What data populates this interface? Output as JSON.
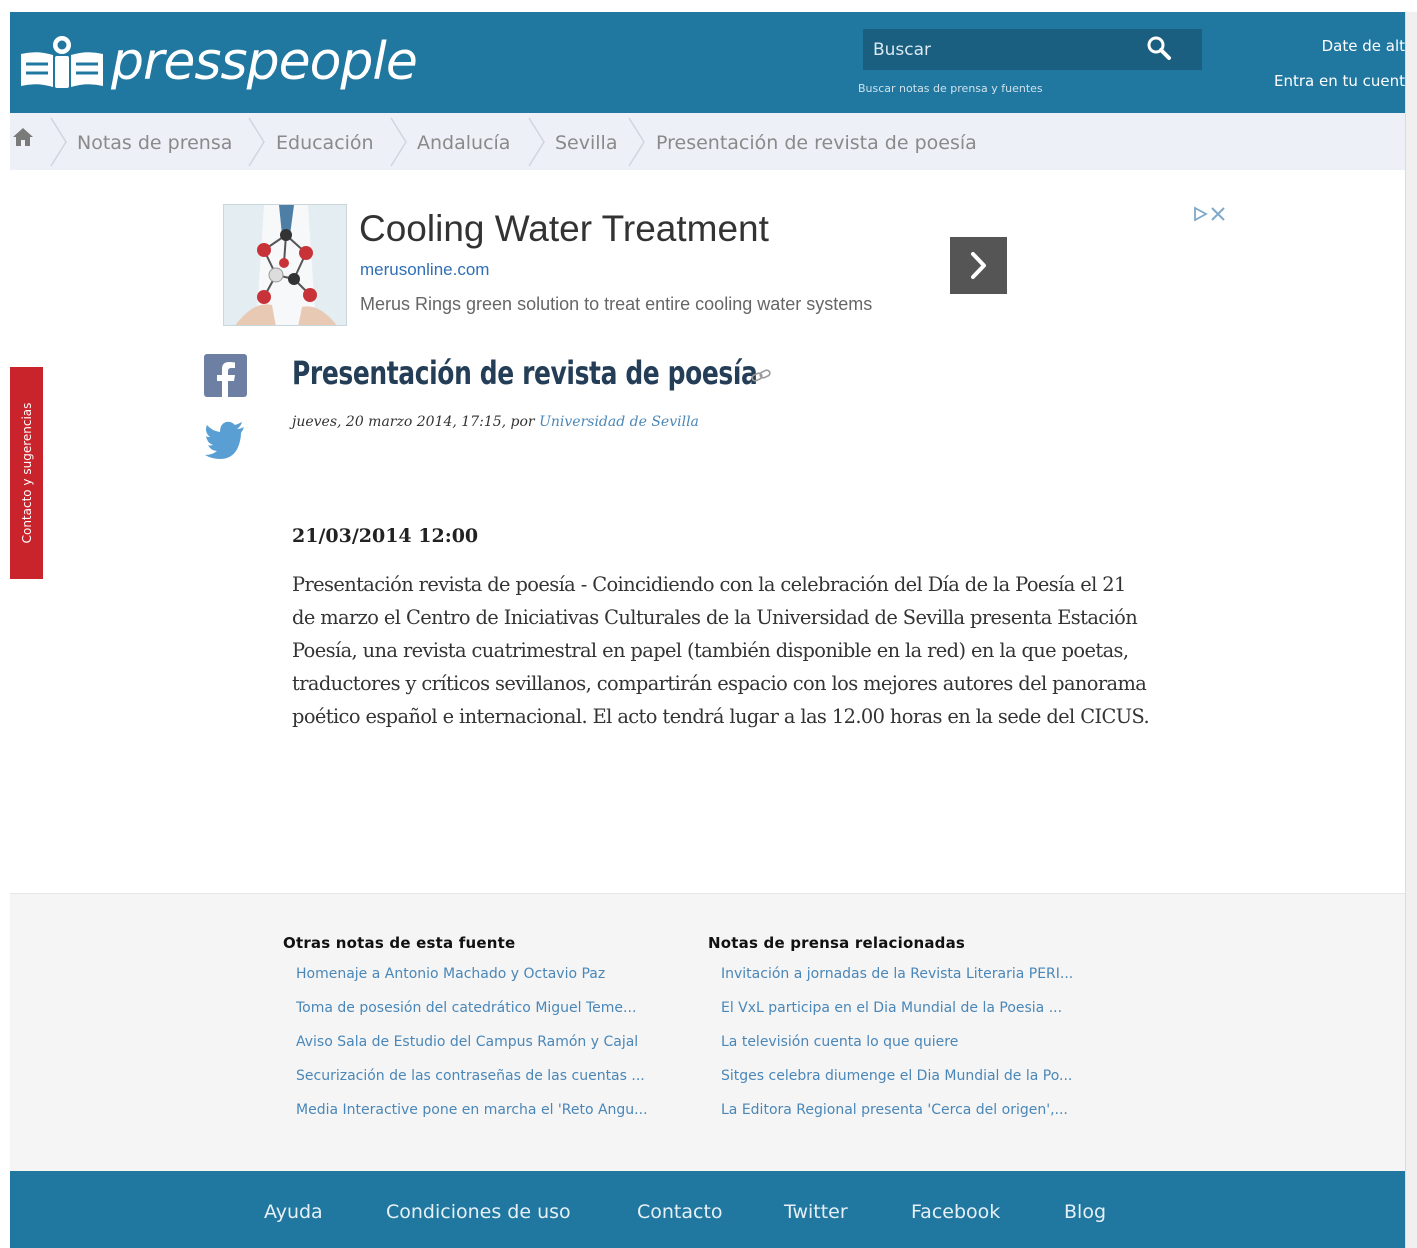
{
  "header": {
    "logo_text": "presspeople",
    "search_placeholder": "Buscar",
    "search_hint": "Buscar notas de prensa y fuentes",
    "signup_link": "Date de alt",
    "login_link": "Entra en tu cuent"
  },
  "breadcrumb": [
    {
      "label": "Notas de prensa"
    },
    {
      "label": "Educación"
    },
    {
      "label": "Andalucía"
    },
    {
      "label": "Sevilla"
    },
    {
      "label": "Presentación de revista de poesía"
    }
  ],
  "ad": {
    "title": "Cooling Water Treatment",
    "url": "merusonline.com",
    "description": "Merus Rings green solution to treat entire cooling water systems"
  },
  "feedback_tab": "Contacto y sugerencias",
  "article": {
    "title": "Presentación de revista de poesía",
    "byline_prefix": "jueves, 20 marzo 2014, 17:15, por ",
    "author": "Universidad de Sevilla",
    "date": "21/03/2014 12:00",
    "body": "Presentación revista de poesía - Coincidiendo con la celebración del Día de la Poesía el 21 de marzo el Centro de Iniciativas Culturales de la Universidad de Sevilla presenta Estación Poesía, una revista cuatrimestral en papel (también disponible en la red) en la que poetas, traductores y críticos sevillanos, compartirán espacio con los mejores autores del panorama poético español e internacional. El acto tendrá lugar a las 12.00 horas en la sede del CICUS."
  },
  "related": {
    "source_heading": "Otras notas de esta fuente",
    "source_items": [
      "Homenaje a Antonio Machado y Octavio Paz",
      "Toma de posesión del catedrático Miguel Teme...",
      "Aviso Sala de Estudio del Campus Ramón y Cajal",
      "Securización de las contraseñas de las cuentas ...",
      "Media Interactive pone en marcha el 'Reto Angu..."
    ],
    "related_heading": "Notas de prensa relacionadas",
    "related_items": [
      "Invitación a jornadas de la Revista Literaria PERI...",
      "El VxL participa en el Dia Mundial de la Poesia ...",
      "La televisión cuenta lo que quiere",
      "Sitges celebra diumenge el Dia Mundial de la Po...",
      "La Editora Regional presenta 'Cerca del origen',..."
    ]
  },
  "footer": {
    "links": [
      "Ayuda",
      "Condiciones de uso",
      "Contacto",
      "Twitter",
      "Facebook",
      "Blog"
    ]
  },
  "colors": {
    "brand_blue": "#2077a0",
    "feedback_red": "#c9232b",
    "link_blue": "#4a87b8",
    "title_navy": "#253e57"
  },
  "icons": {
    "logo": "presspeople-logo-icon",
    "search": "search-icon",
    "home": "home-icon",
    "permalink": "link-icon",
    "facebook": "facebook-icon",
    "twitter": "twitter-icon",
    "ad_next": "chevron-right-icon",
    "ad_choices": "adchoices-icon"
  }
}
